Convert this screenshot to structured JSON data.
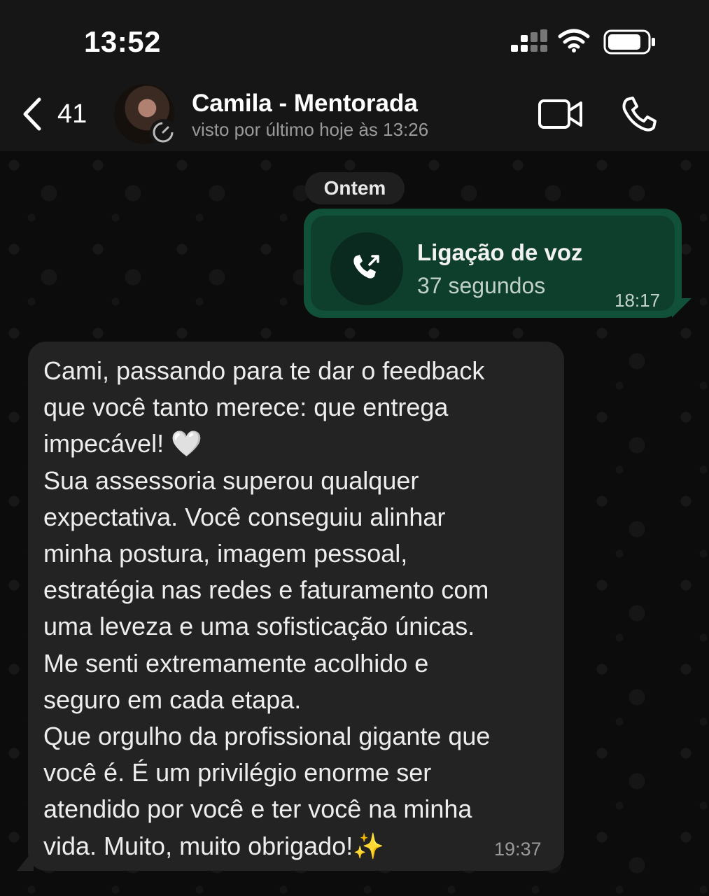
{
  "status_bar": {
    "time": "13:52"
  },
  "header": {
    "back_count": "41",
    "contact_name": "Camila - Mentorada",
    "contact_status": "visto por último hoje às 13:26"
  },
  "chat": {
    "date_divider": "Ontem",
    "call_message": {
      "title": "Ligação de voz",
      "duration": "37 segundos",
      "time": "18:17"
    },
    "text_message": {
      "text": "Cami, passando para te dar o feedback\nque você tanto merece: que entrega\nimpecável! 🤍\nSua assessoria superou qualquer\nexpectativa. Você conseguiu alinhar\nminha postura, imagem pessoal,\nestratégia nas redes e faturamento com\numa leveza e uma sofisticação únicas.\nMe senti extremamente acolhido e\nseguro em cada etapa.\nQue orgulho da profissional gigante que\nvocê é. É um privilégio enorme ser\natendido por você e ter você na minha\nvida. Muito, muito obrigado!✨",
      "time": "19:37"
    }
  },
  "colors": {
    "outgoing_bubble": "#11513a",
    "incoming_bubble": "#232323",
    "header_bg": "#161616"
  },
  "icons": [
    "cellular-signal-icon",
    "wifi-icon",
    "battery-icon",
    "back-chevron-icon",
    "video-camera-icon",
    "phone-icon",
    "outgoing-call-icon"
  ]
}
